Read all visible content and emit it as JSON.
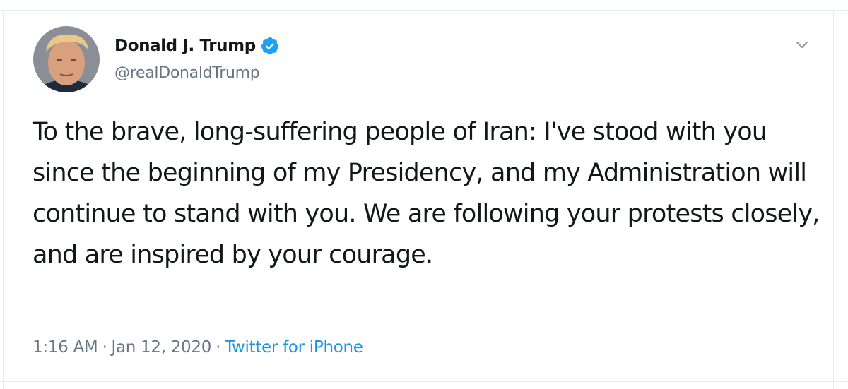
{
  "tweet": {
    "author": {
      "display_name": "Donald J. Trump",
      "handle": "@realDonaldTrump",
      "verified": true
    },
    "text": "To the brave, long-suffering people of Iran: I've stood with you since the beginning of my Presidency, and my Administration will continue to stand with you. We are following your protests closely, and are inspired by your courage.",
    "time": "1:16 AM",
    "date": "Jan 12, 2020",
    "separator": "·",
    "source": "Twitter for iPhone"
  },
  "colors": {
    "text": "#14171a",
    "muted": "#657786",
    "link": "#1b95e0",
    "verified": "#1da1f2",
    "border": "#e6ecf0"
  },
  "icons": {
    "verified": "verified-badge-icon",
    "menu": "chevron-down-icon"
  }
}
